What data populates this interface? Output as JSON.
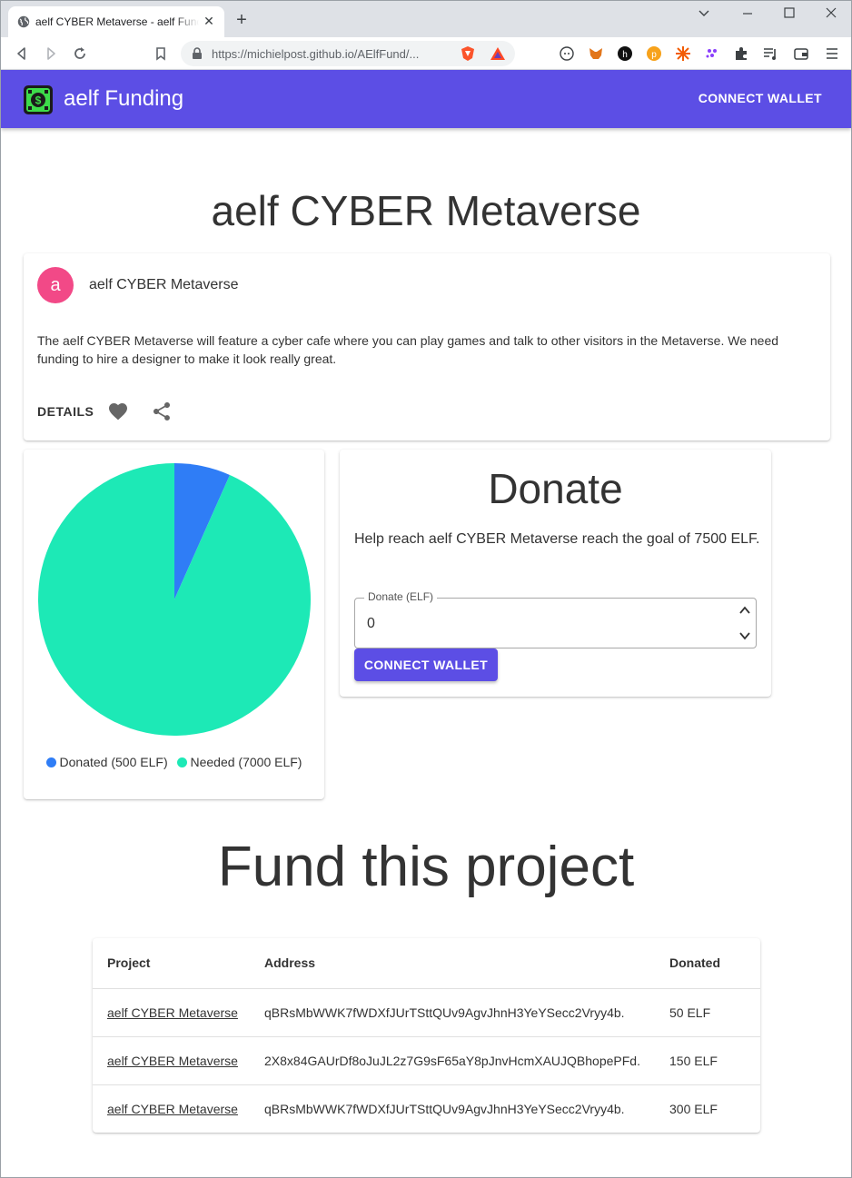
{
  "browser": {
    "tab_title": "aelf CYBER Metaverse - aelf Funding",
    "url": "https://michielpost.github.io/AElfFund/..."
  },
  "appbar": {
    "title": "aelf Funding",
    "connect_label": "CONNECT WALLET",
    "color": "#5c4ee5"
  },
  "page": {
    "title": "aelf CYBER Metaverse"
  },
  "info_card": {
    "avatar_letter": "a",
    "header": "aelf CYBER Metaverse",
    "description": "The aelf CYBER Metaverse will feature a cyber cafe where you can play games and talk to other visitors in the Metaverse. We need funding to hire a designer to make it look really great.",
    "details_label": "DETAILS"
  },
  "chart_data": {
    "type": "pie",
    "labels": [
      "Donated (500 ELF)",
      "Needed (7000 ELF)"
    ],
    "values": [
      500,
      7000
    ],
    "colors": [
      "#2f7df6",
      "#1de9b6"
    ],
    "legend": "bottom"
  },
  "donate": {
    "title": "Donate",
    "text": "Help reach aelf CYBER Metaverse reach the goal of 7500 ELF.",
    "field_label": "Donate (ELF)",
    "field_value": "0",
    "connect_label": "CONNECT WALLET"
  },
  "fund": {
    "title": "Fund this project",
    "headers": [
      "Project",
      "Address",
      "Donated"
    ],
    "rows": [
      {
        "project": "aelf CYBER Metaverse",
        "address": "qBRsMbWWK7fWDXfJUrTSttQUv9AgvJhnH3YeYSecc2Vryy4b.",
        "donated": "50 ELF"
      },
      {
        "project": "aelf CYBER Metaverse",
        "address": "2X8x84GAUrDf8oJuJL2z7G9sF65aY8pJnvHcmXAUJQBhopePFd.",
        "donated": "150 ELF"
      },
      {
        "project": "aelf CYBER Metaverse",
        "address": "qBRsMbWWK7fWDXfJUrTSttQUv9AgvJhnH3YeYSecc2Vryy4b.",
        "donated": "300 ELF"
      }
    ]
  }
}
